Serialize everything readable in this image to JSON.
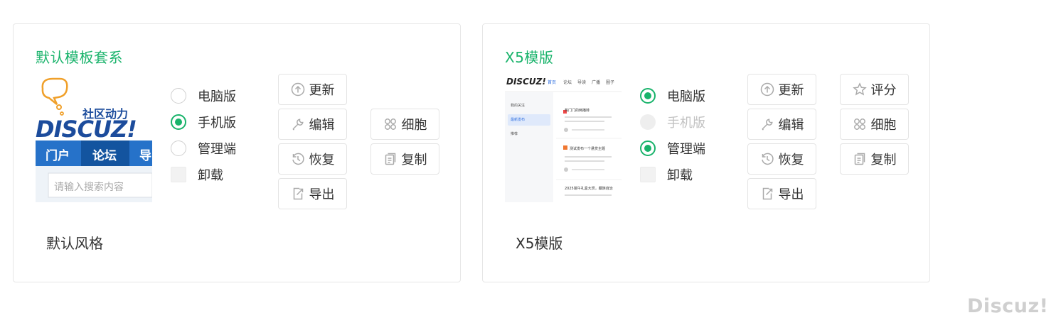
{
  "cards": [
    {
      "title": "默认模板套系",
      "style_name": "默认风格",
      "thumbnail": {
        "tagline": "社区动力",
        "logo": "DISCUZ!",
        "nav": [
          "门户",
          "论坛",
          "导"
        ],
        "search_placeholder": "请输入搜索内容"
      },
      "options": [
        {
          "label": "电脑版",
          "type": "radio",
          "state": "unchecked"
        },
        {
          "label": "手机版",
          "type": "radio",
          "state": "checked"
        },
        {
          "label": "管理端",
          "type": "radio",
          "state": "unchecked"
        },
        {
          "label": "卸载",
          "type": "checkbox",
          "state": "unchecked"
        }
      ],
      "buttons": {
        "update": "更新",
        "edit": "编辑",
        "restore": "恢复",
        "export": "导出",
        "cell": "细胞",
        "copy": "复制"
      }
    },
    {
      "title": "X5模版",
      "style_name": "X5模版",
      "thumbnail": {
        "logo": "DISCUZ!",
        "nav": [
          "首页",
          "论坛",
          "导读",
          "广播",
          "圈子"
        ],
        "side": [
          "我的关注",
          "最新发布",
          "推荐"
        ],
        "posts": [
          "热门门的两播转",
          "测试发布一个悬赏主题",
          "2025端午礼盒大赏，藏族自治"
        ]
      },
      "options": [
        {
          "label": "电脑版",
          "type": "radio",
          "state": "checked"
        },
        {
          "label": "手机版",
          "type": "radio",
          "state": "disabled"
        },
        {
          "label": "管理端",
          "type": "radio",
          "state": "checked"
        },
        {
          "label": "卸载",
          "type": "checkbox",
          "state": "unchecked"
        }
      ],
      "buttons": {
        "update": "更新",
        "edit": "编辑",
        "restore": "恢复",
        "export": "导出",
        "rate": "评分",
        "cell": "细胞",
        "copy": "复制"
      }
    }
  ],
  "watermark": "Discuz!",
  "colors": {
    "accent": "#19b36b",
    "border": "#e6e6e6",
    "muted": "#c2c2c2",
    "logo_blue": "#1c4c9c",
    "nav_blue": "#2672c9"
  }
}
